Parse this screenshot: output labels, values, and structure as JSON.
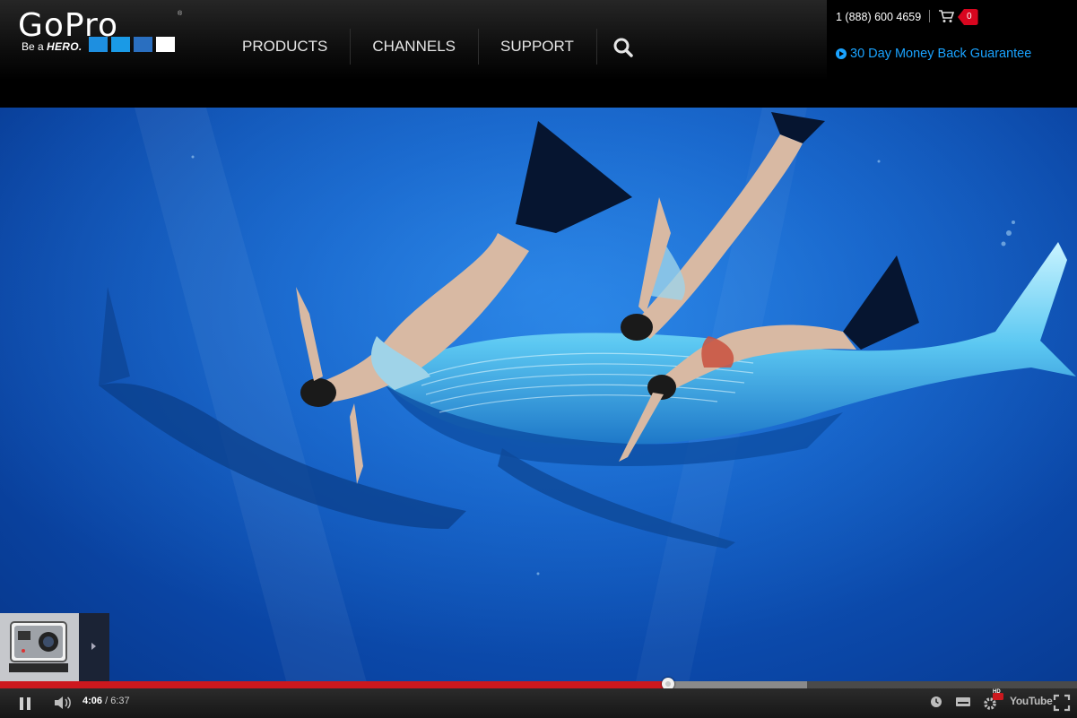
{
  "brand": {
    "logo_text": "GoPro",
    "registered_mark": "®",
    "tagline_prefix": "Be a",
    "tagline_emphasis": "HERO.",
    "block_colors": [
      "#1e8fe0",
      "#1a9ae6",
      "#2a6fc0",
      "#ffffff"
    ]
  },
  "nav": {
    "items": [
      {
        "label": "PRODUCTS"
      },
      {
        "label": "CHANNELS"
      },
      {
        "label": "SUPPORT"
      }
    ],
    "search_icon": "search-icon"
  },
  "utility": {
    "phone": "1 (888) 600 4659",
    "cart_icon": "cart-icon",
    "cart_count": "0",
    "guarantee_label": "30 Day Money Back Guarantee"
  },
  "player": {
    "current_time": "4:06",
    "separator": " / ",
    "duration": "6:37",
    "progress_fraction": 0.62,
    "buffered_fraction": 0.749,
    "hd_badge": "HD",
    "youtube_label": "YouTube",
    "icons": [
      "pause-icon",
      "volume-icon",
      "watch-later-icon",
      "captions-icon",
      "settings-icon",
      "youtube-logo-icon",
      "fullscreen-icon"
    ],
    "colors": {
      "played": "#cc181e",
      "accent_link": "#1aa3ff"
    }
  }
}
